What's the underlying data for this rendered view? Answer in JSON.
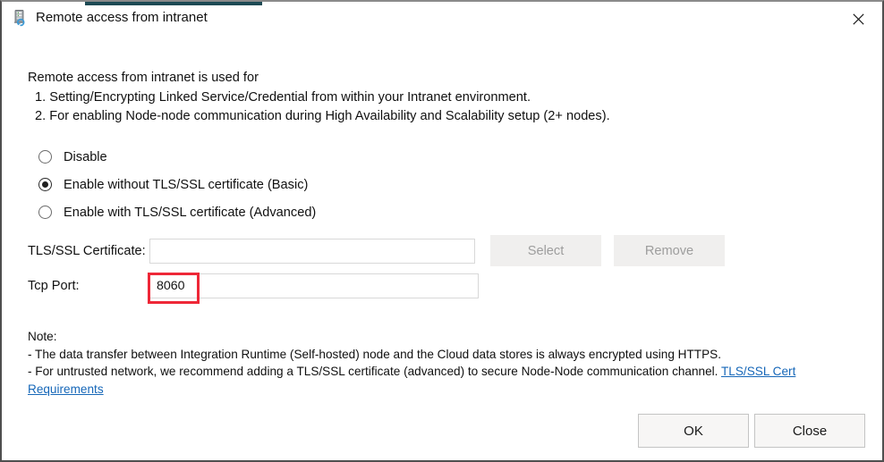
{
  "window": {
    "title": "Remote access from intranet",
    "icon": "server-refresh-icon",
    "close_label": "✕",
    "accent_color": "#1d4a54",
    "border_color": "#4f4f4f"
  },
  "intro": {
    "heading": "Remote access from intranet is used for",
    "item1": "1. Setting/Encrypting Linked Service/Credential from within your Intranet environment.",
    "item2": "2. For enabling Node-node communication during High Availability and Scalability setup (2+ nodes)."
  },
  "radios": {
    "selected_index": 1,
    "options": [
      {
        "label": "Disable",
        "selected": false
      },
      {
        "label": "Enable without TLS/SSL certificate (Basic)",
        "selected": true
      },
      {
        "label": "Enable with TLS/SSL certificate (Advanced)",
        "selected": false
      }
    ]
  },
  "certificate_row": {
    "label": "TLS/SSL Certificate:",
    "value": "",
    "placeholder": "",
    "select_button": "Select",
    "remove_button": "Remove",
    "buttons_disabled": true
  },
  "port_row": {
    "label": "Tcp Port:",
    "value": "8060",
    "placeholder": "",
    "highlight_color": "#ee2737"
  },
  "note": {
    "title": "Note:",
    "line1": "- The data transfer between Integration Runtime (Self-hosted) node and the Cloud data stores is always encrypted using HTTPS.",
    "line2_prefix": "- For untrusted network, we recommend adding a TLS/SSL certificate (advanced) to secure Node-Node communication channel. ",
    "link_text": "TLS/SSL Cert Requirements",
    "link_color": "#1667b8"
  },
  "footer": {
    "ok_label": "OK",
    "close_label": "Close"
  }
}
